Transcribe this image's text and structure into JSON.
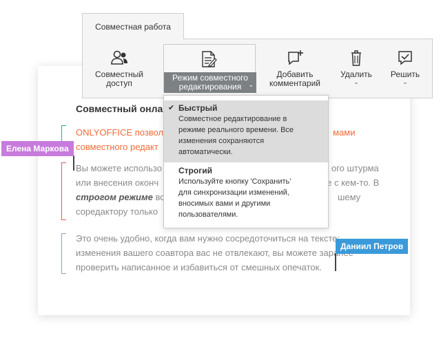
{
  "toolbar": {
    "tab_label": "Совместная работа",
    "share": {
      "label_line1": "Совместный",
      "label_line2": "доступ"
    },
    "co_edit_mode": {
      "label_line1": "Режим совместного",
      "label_line2": "редактирования"
    },
    "add_comment": {
      "label_line1": "Добавить",
      "label_line2": "комментарий"
    },
    "delete": {
      "label": "Удалить"
    },
    "resolve": {
      "label": "Решить"
    }
  },
  "dropdown": {
    "fast": {
      "title": "Быстрый",
      "desc": [
        "Совместное редактирование в",
        "режиме реального времени. Все",
        "изменения сохраняются",
        "автоматически."
      ],
      "selected": true
    },
    "strict": {
      "title": "Строгий",
      "desc": [
        "Используйте кнопку 'Сохранить'",
        "для синхронизации изменений,",
        "вносимых вами и другими",
        "пользователями."
      ],
      "selected": false
    }
  },
  "document": {
    "title": "Совместный онла",
    "p1": [
      "ONLYOFFICE позвол",
      "мами",
      "совместного редакт"
    ],
    "p2": [
      "Вы можете использо",
      "ого штурма",
      "или внесения оконч",
      "е с кем-то. В",
      "строгом режиме",
      " все",
      "шему",
      "соредактору только"
    ],
    "p3": [
      "Это очень удобно, когда вам нужно сосредоточиться на тексте:",
      "изменения вашего соавтора вас не отвлекают, вы можете заранее",
      "проверить написанное и избавиться от смешных опечаток."
    ]
  },
  "collaborators": {
    "elena": {
      "name": "Елена Маркова",
      "color": "#c77bdc"
    },
    "daniil": {
      "name": "Даниил Петров",
      "color": "#3a9ad9"
    }
  },
  "icons": {
    "share": "users-icon",
    "co_edit_mode": "document-edit-icon",
    "add_comment": "comment-plus-icon",
    "delete": "trash-icon",
    "resolve": "comment-check-icon",
    "check": "checkmark-icon"
  }
}
